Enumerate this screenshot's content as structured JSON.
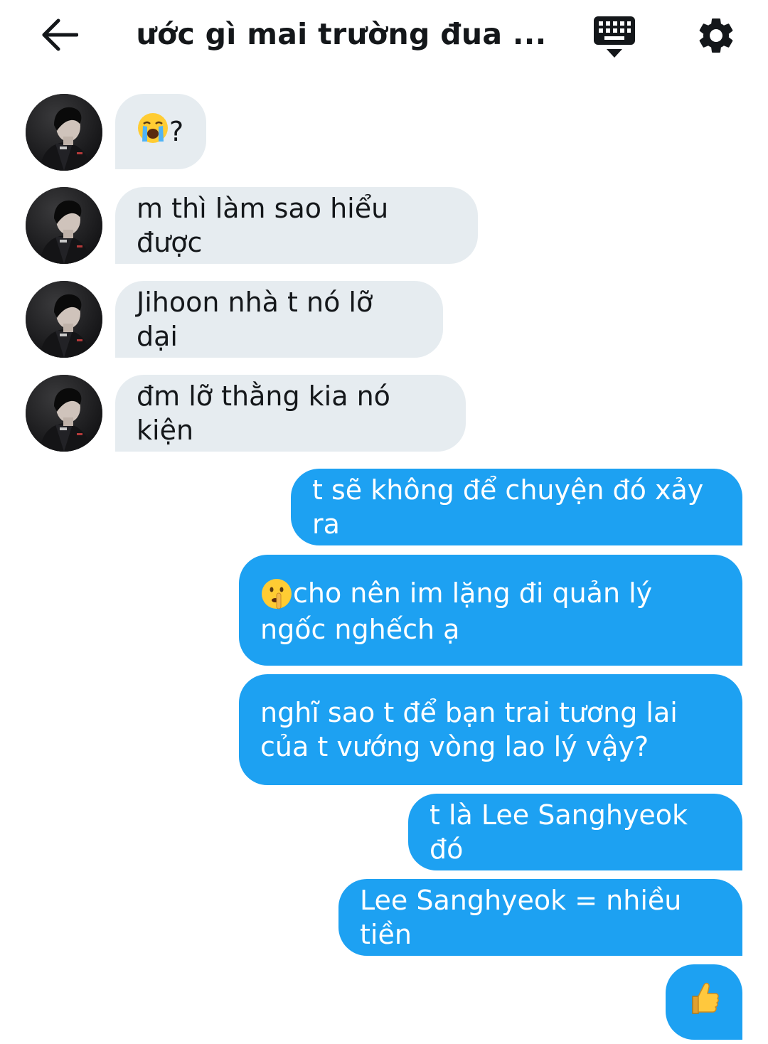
{
  "header": {
    "title": "ước gì mai trường đua ...",
    "back_icon": "arrow-left-icon",
    "keyboard_icon": "keyboard-hide-icon",
    "settings_icon": "gear-icon"
  },
  "colors": {
    "incoming_bubble": "#e6ecf0",
    "outgoing_bubble": "#1da1f2",
    "text_dark": "#14171a"
  },
  "messages": [
    {
      "direction": "incoming",
      "emoji": "loudly-crying-face",
      "text": "?"
    },
    {
      "direction": "incoming",
      "text": "m thì làm sao hiểu được"
    },
    {
      "direction": "incoming",
      "text": "Jihoon nhà t nó lỡ dại"
    },
    {
      "direction": "incoming",
      "text": "đm lỡ thằng kia nó kiện"
    },
    {
      "direction": "outgoing",
      "text": "t sẽ không để chuyện đó xảy ra"
    },
    {
      "direction": "outgoing",
      "emoji": "shushing-face",
      "text": "cho nên im lặng đi quản lý ngốc nghếch ạ"
    },
    {
      "direction": "outgoing",
      "text": "nghĩ sao t để bạn trai tương lai của t vướng vòng lao lý vậy?"
    },
    {
      "direction": "outgoing",
      "text": "t là Lee Sanghyeok đó"
    },
    {
      "direction": "outgoing",
      "text": "Lee Sanghyeok = nhiều tiền"
    },
    {
      "direction": "outgoing",
      "emoji": "thumbs-up"
    }
  ]
}
